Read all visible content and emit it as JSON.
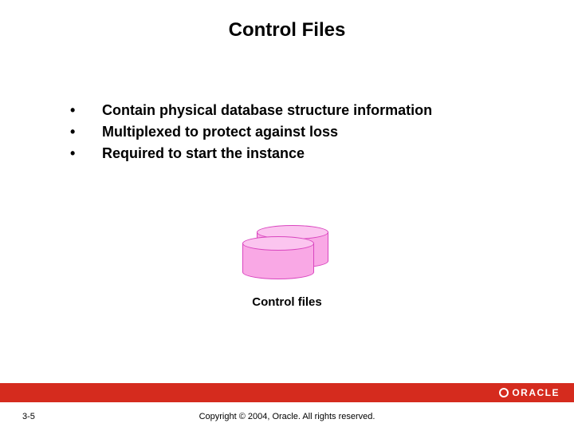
{
  "title": "Control Files",
  "bullets": [
    "Contain physical database structure information",
    "Multiplexed to protect against loss",
    "Required to start the instance"
  ],
  "figure_label": "Control files",
  "logo_text": "ORACLE",
  "page_number": "3-5",
  "copyright": "Copyright © 2004, Oracle. All rights reserved."
}
